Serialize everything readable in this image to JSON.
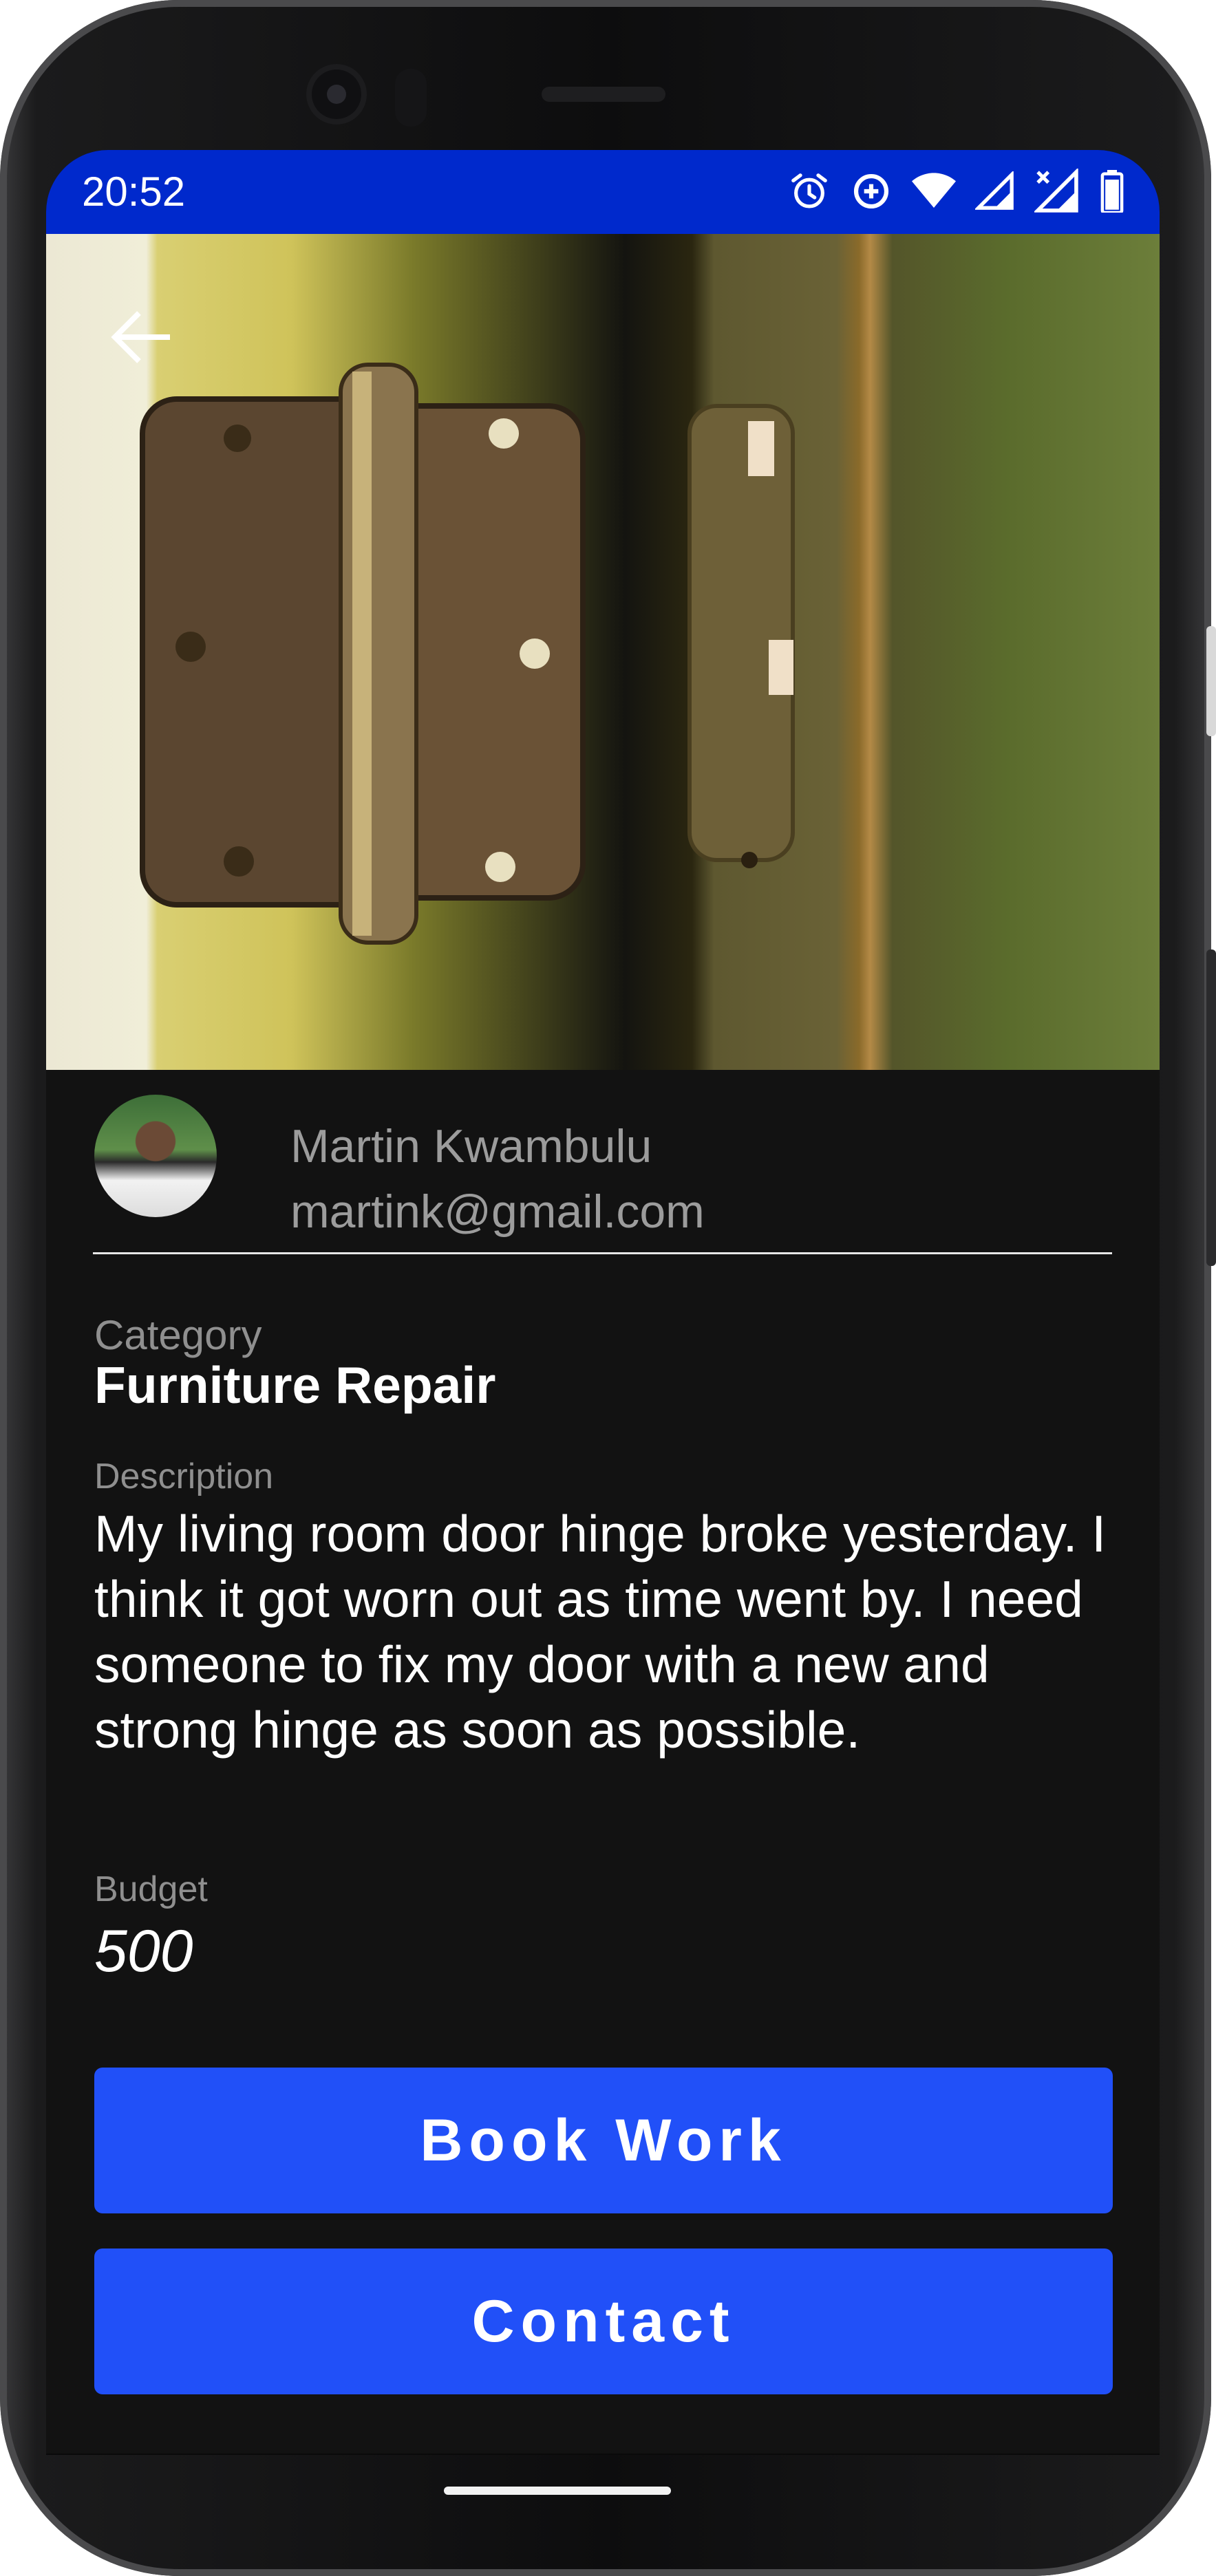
{
  "status_bar": {
    "time": "20:52",
    "icons": [
      "alarm-icon",
      "data-saver-icon",
      "wifi-icon",
      "signal-icon",
      "signal-no-data-icon",
      "battery-icon"
    ]
  },
  "hero": {
    "back_icon": "arrow-back-icon"
  },
  "poster": {
    "name": "Martin Kwambulu",
    "email": "martink@gmail.com"
  },
  "job": {
    "category_label": "Category",
    "category": "Furniture Repair",
    "description_label": "Description",
    "description": "My living room door hinge broke yesterday. I think it got worn out as time went by. I need someone to fix my door with a new and strong hinge as soon as possible.",
    "budget_label": "Budget",
    "budget": "500"
  },
  "actions": {
    "book_label": "Book Work",
    "contact_label": "Contact"
  },
  "colors": {
    "status_bar": "#0029cc",
    "button": "#2150f8",
    "background": "#121212"
  }
}
